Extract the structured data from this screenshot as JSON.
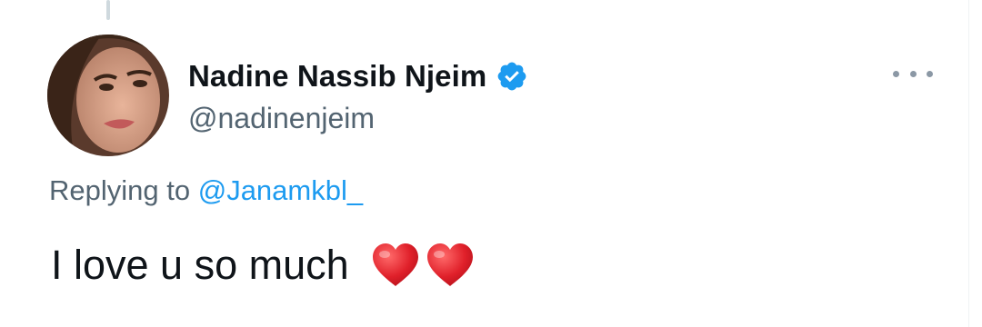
{
  "tweet": {
    "display_name": "Nadine Nassib Njeim",
    "handle": "@nadinenjeim",
    "verified": true,
    "replying_prefix": "Replying to",
    "replying_to": "@Janamkbl_",
    "text": "I love u so much",
    "emojis": [
      "heart-icon",
      "heart-icon"
    ]
  },
  "icons": {
    "verified": "verified-badge-icon",
    "more": "more-options-icon",
    "heart": "red-heart-icon"
  },
  "colors": {
    "accent": "#1d9bf0",
    "secondary_text": "#536471",
    "primary_text": "#0f1419",
    "heart": "#e0202a"
  }
}
